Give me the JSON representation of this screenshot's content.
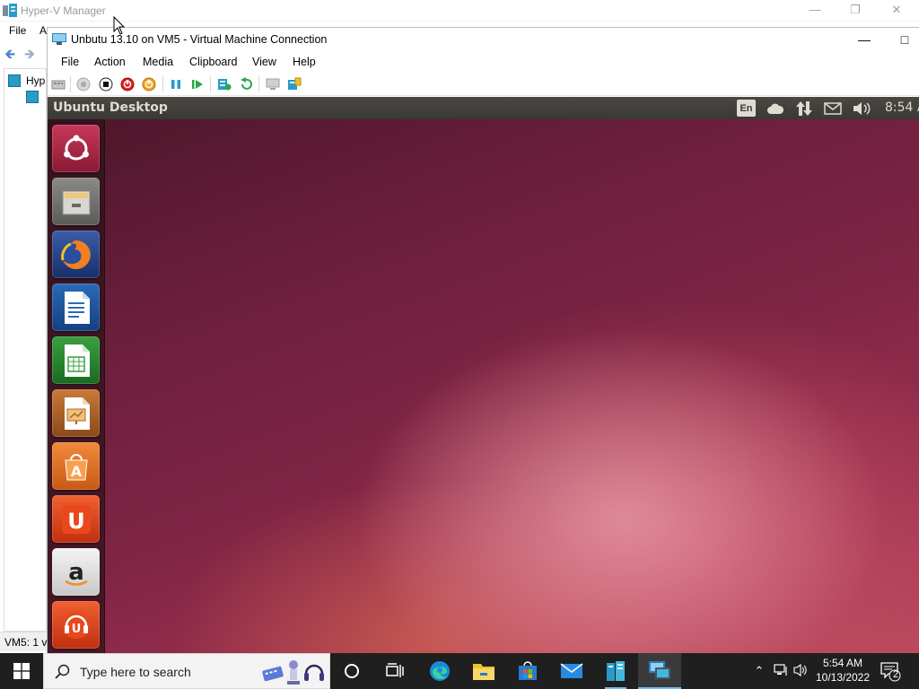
{
  "hyperv": {
    "title": "Hyper-V Manager",
    "menu": [
      "File",
      "A"
    ],
    "tree_root": "Hyp",
    "status_text": "VM5:  1 v"
  },
  "vm_connection": {
    "title": "Unbutu 13.10 on VM5 - Virtual Machine Connection",
    "menu": [
      "File",
      "Action",
      "Media",
      "Clipboard",
      "View",
      "Help"
    ],
    "toolbar_icons": [
      "ctrl-alt-del-icon",
      "start-icon",
      "turn-off-icon",
      "shut-down-icon",
      "save-icon",
      "pause-icon",
      "resume-icon",
      "checkpoint-icon",
      "revert-icon",
      "enhanced-session-icon",
      "share-icon"
    ]
  },
  "ubuntu": {
    "panel_title": "Ubuntu Desktop",
    "keyboard_indicator": "En",
    "time": "8:54 A",
    "indicators": [
      "cloud-icon",
      "network-icon",
      "mail-icon",
      "volume-icon"
    ],
    "launcher": [
      "dash-home-icon",
      "files-icon",
      "firefox-icon",
      "libreoffice-writer-icon",
      "libreoffice-calc-icon",
      "libreoffice-impress-icon",
      "software-center-icon",
      "ubuntu-one-icon",
      "amazon-icon",
      "ubuntu-one-music-icon"
    ]
  },
  "taskbar": {
    "search_placeholder": "Type here to search",
    "time": "5:54 AM",
    "date": "10/13/2022",
    "notification_count": "2",
    "apps": [
      "cortana-icon",
      "task-view-icon",
      "edge-icon",
      "file-explorer-icon",
      "store-icon",
      "mail-icon",
      "server-manager-icon",
      "hyper-v-manager-icon"
    ]
  },
  "colors": {
    "ubuntu_panel": "#3a3935",
    "taskbar": "#1f1f1f",
    "accent": "#76b9ed"
  }
}
